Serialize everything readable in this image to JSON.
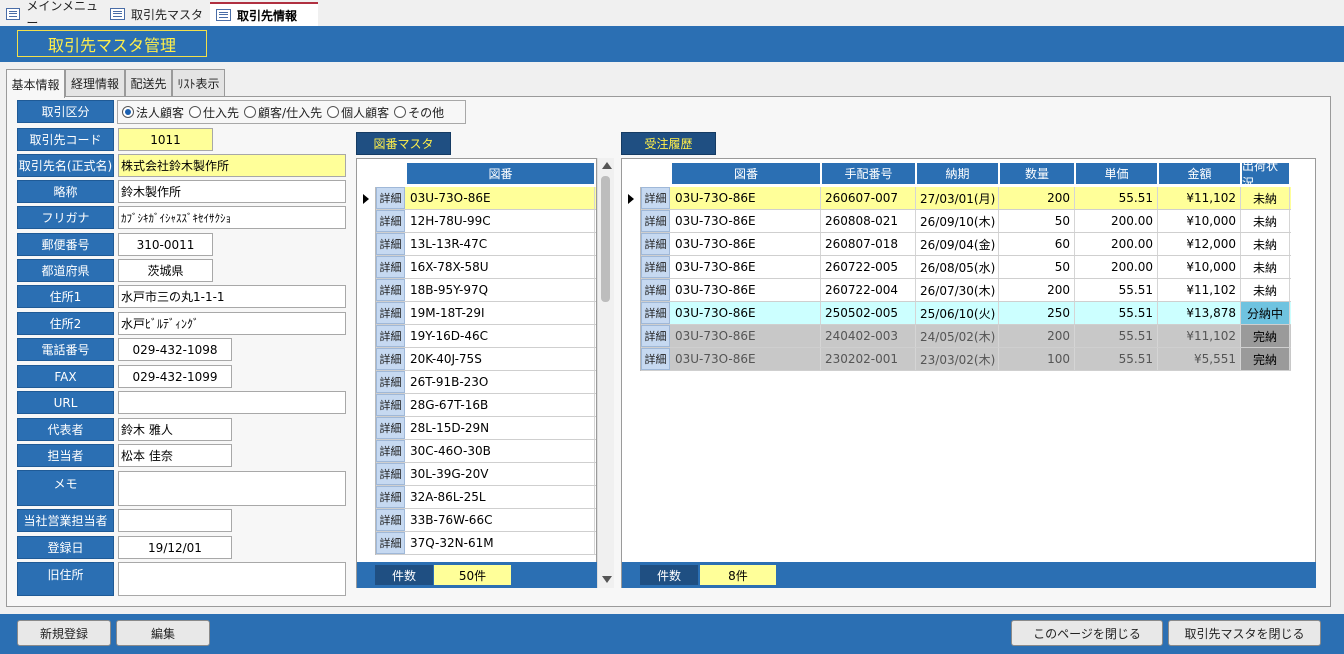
{
  "doc_tabs": [
    {
      "label": "メインメニュー"
    },
    {
      "label": "取引先マスタ"
    },
    {
      "label": "取引先情報"
    }
  ],
  "header": {
    "title": "取引先マスタ管理"
  },
  "form_tabs": [
    {
      "label": "基本情報"
    },
    {
      "label": "経理情報"
    },
    {
      "label": "配送先"
    },
    {
      "label": "ﾘｽﾄ表示"
    }
  ],
  "fields": {
    "kubun": {
      "label": "取引区分",
      "options": [
        "法人顧客",
        "仕入先",
        "顧客/仕入先",
        "個人顧客",
        "その他"
      ],
      "selected": "法人顧客"
    },
    "code": {
      "label": "取引先コード",
      "value": "1011"
    },
    "name": {
      "label": "取引先名(正式名)",
      "value": "株式会社鈴木製作所"
    },
    "short": {
      "label": "略称",
      "value": "鈴木製作所"
    },
    "kana": {
      "label": "フリガナ",
      "value": "ｶﾌﾞｼｷｶﾞｲｼｬｽｽﾞｷｾｲｻｸｼｮ"
    },
    "zip": {
      "label": "郵便番号",
      "value": "310-0011"
    },
    "pref": {
      "label": "都道府県",
      "value": "茨城県"
    },
    "addr1": {
      "label": "住所1",
      "value": "水戸市三の丸1-1-1"
    },
    "addr2": {
      "label": "住所2",
      "value": "水戸ﾋﾞﾙﾃﾞｨﾝｸﾞ"
    },
    "tel": {
      "label": "電話番号",
      "value": "029-432-1098"
    },
    "fax": {
      "label": "FAX",
      "value": "029-432-1099"
    },
    "url": {
      "label": "URL",
      "value": ""
    },
    "rep": {
      "label": "代表者",
      "value": "鈴木 雅人"
    },
    "contact": {
      "label": "担当者",
      "value": "松本 佳奈"
    },
    "memo": {
      "label": "メモ",
      "value": ""
    },
    "sales": {
      "label": "当社営業担当者",
      "value": ""
    },
    "regdate": {
      "label": "登録日",
      "value": "19/12/01"
    },
    "oldaddr": {
      "label": "旧住所",
      "value": ""
    }
  },
  "zuban": {
    "title": "図番マスタ",
    "column": "図番",
    "detail_label": "詳細",
    "rows": [
      "03U-73O-86E",
      "12H-78U-99C",
      "13L-13R-47C",
      "16X-78X-58U",
      "18B-95Y-97Q",
      "19M-18T-29I",
      "19Y-16D-46C",
      "20K-40J-75S",
      "26T-91B-23O",
      "28G-67T-16B",
      "28L-15D-29N",
      "30C-46O-30B",
      "30L-39G-20V",
      "32A-86L-25L",
      "33B-76W-66C",
      "37Q-32N-61M"
    ],
    "count_label": "件数",
    "count_value": "50件"
  },
  "orders": {
    "title": "受注履歴",
    "columns": [
      "図番",
      "手配番号",
      "納期",
      "数量",
      "単価",
      "金額",
      "出荷状況"
    ],
    "detail_label": "詳細",
    "rows": [
      [
        "03U-73O-86E",
        "260607-007",
        "27/03/01(月)",
        "200",
        "55.51",
        "¥11,102",
        "未納"
      ],
      [
        "03U-73O-86E",
        "260808-021",
        "26/09/10(木)",
        "50",
        "200.00",
        "¥10,000",
        "未納"
      ],
      [
        "03U-73O-86E",
        "260807-018",
        "26/09/04(金)",
        "60",
        "200.00",
        "¥12,000",
        "未納"
      ],
      [
        "03U-73O-86E",
        "260722-005",
        "26/08/05(水)",
        "50",
        "200.00",
        "¥10,000",
        "未納"
      ],
      [
        "03U-73O-86E",
        "260722-004",
        "26/07/30(木)",
        "200",
        "55.51",
        "¥11,102",
        "未納"
      ],
      [
        "03U-73O-86E",
        "250502-005",
        "25/06/10(火)",
        "250",
        "55.51",
        "¥13,878",
        "分納中"
      ],
      [
        "03U-73O-86E",
        "240402-003",
        "24/05/02(木)",
        "200",
        "55.51",
        "¥11,102",
        "完納"
      ],
      [
        "03U-73O-86E",
        "230202-001",
        "23/03/02(木)",
        "100",
        "55.51",
        "¥5,551",
        "完納"
      ]
    ],
    "count_label": "件数",
    "count_value": "8件"
  },
  "buttons": {
    "new": "新規登録",
    "edit": "編集",
    "close_page": "このページを閉じる",
    "close_master": "取引先マスタを閉じる"
  }
}
